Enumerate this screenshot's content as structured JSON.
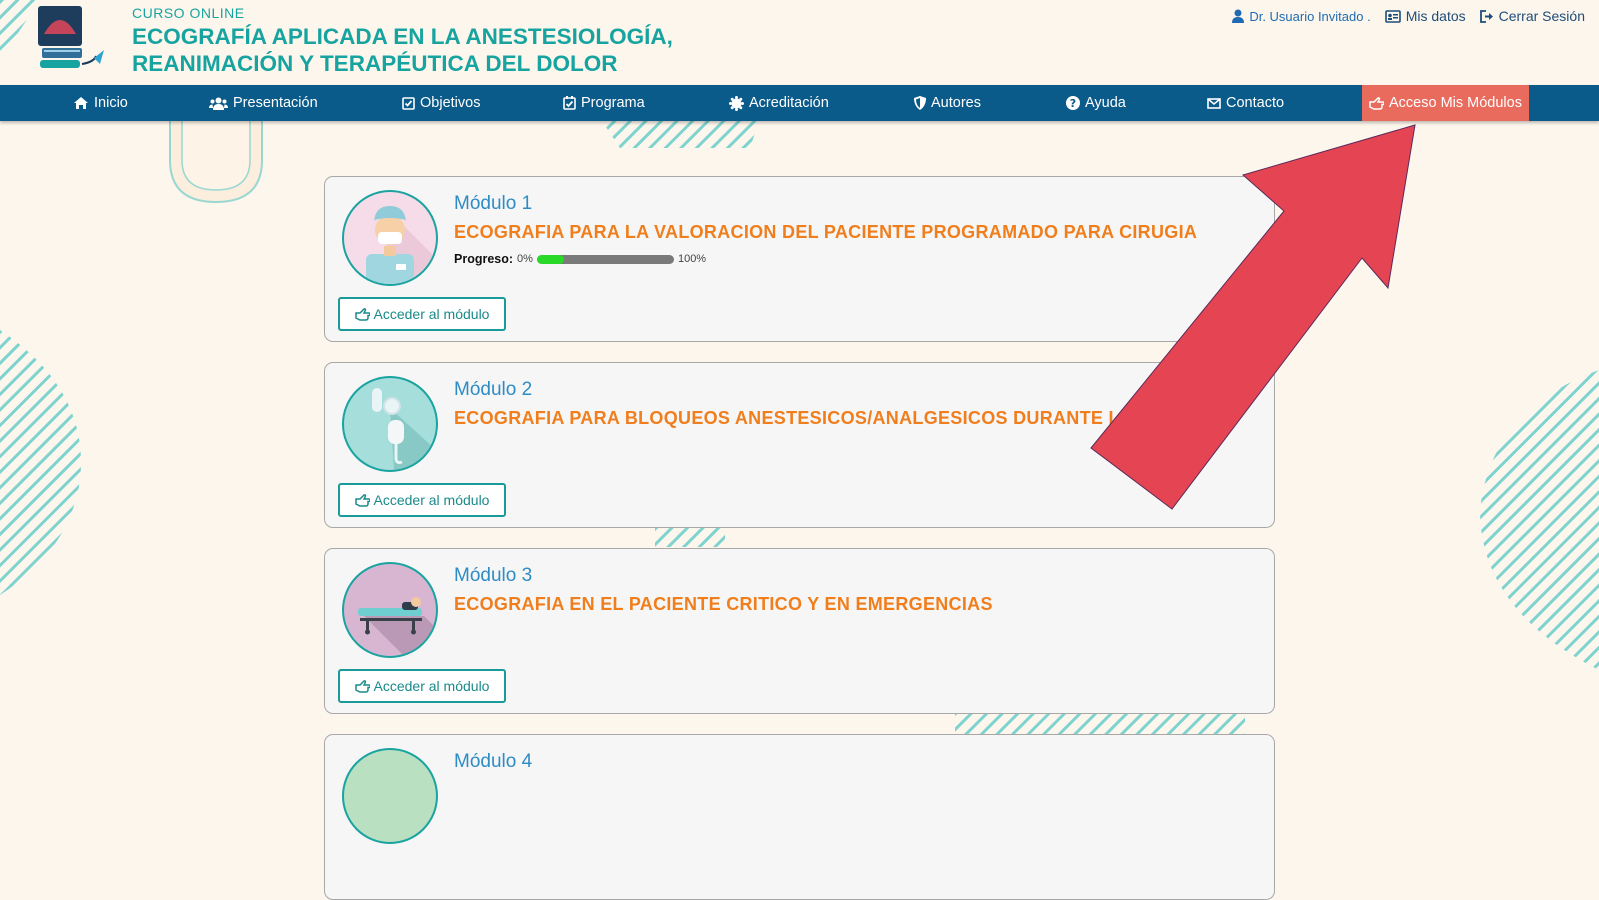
{
  "header": {
    "course_label": "CURSO ONLINE",
    "course_title_line1": "ECOGRAFÍA APLICADA EN LA ANESTESIOLOGÍA,",
    "course_title_line2": "REANIMACIÓN Y TERAPÉUTICA DEL DOLOR",
    "logo_icon": "ultrasound-machine-icon"
  },
  "user_menu": {
    "user_label": "Dr. Usuario Invitado .",
    "mis_datos": "Mis datos",
    "cerrar_sesion": "Cerrar Sesión"
  },
  "nav": {
    "items": [
      {
        "label": "Inicio",
        "icon": "home-icon"
      },
      {
        "label": "Presentación",
        "icon": "users-icon"
      },
      {
        "label": "Objetivos",
        "icon": "check-square-icon"
      },
      {
        "label": "Programa",
        "icon": "calendar-check-icon"
      },
      {
        "label": "Acreditación",
        "icon": "certificate-icon"
      },
      {
        "label": "Autores",
        "icon": "shield-icon"
      },
      {
        "label": "Ayuda",
        "icon": "question-circle-icon"
      },
      {
        "label": "Contacto",
        "icon": "envelope-icon"
      }
    ],
    "active_item": {
      "label": "Acceso Mis Módulos",
      "icon": "hand-pointer-icon"
    }
  },
  "colors": {
    "page_bg": "#fdf6ec",
    "teal": "#17a4a0",
    "nav_bg": "#0a5a8a",
    "active_tab": "#e96b5e",
    "module_title": "#f07e1c",
    "module_number": "#2e8cc4",
    "arrow": "#e54452"
  },
  "modules": [
    {
      "number": "Módulo 1",
      "title": "ECOGRAFIA PARA LA VALORACION DEL PACIENTE PROGRAMADO PARA CIRUGIA",
      "progress_label": "Progreso:",
      "progress_min": "0%",
      "progress_max": "100%",
      "progress_fill": 0.2,
      "button": "Acceder al módulo",
      "image": "doctor-icon"
    },
    {
      "number": "Módulo 2",
      "title": "ECOGRAFIA PARA BLOQUEOS ANESTESICOS/ANALGESICOS DURANTE LA CIRUGIA",
      "button": "Acceder al módulo",
      "image": "oxygen-mask-icon"
    },
    {
      "number": "Módulo 3",
      "title": "ECOGRAFIA EN EL PACIENTE CRITICO Y EN EMERGENCIAS",
      "button": "Acceder al módulo",
      "image": "stretcher-icon"
    },
    {
      "number": "Módulo 4"
    }
  ]
}
